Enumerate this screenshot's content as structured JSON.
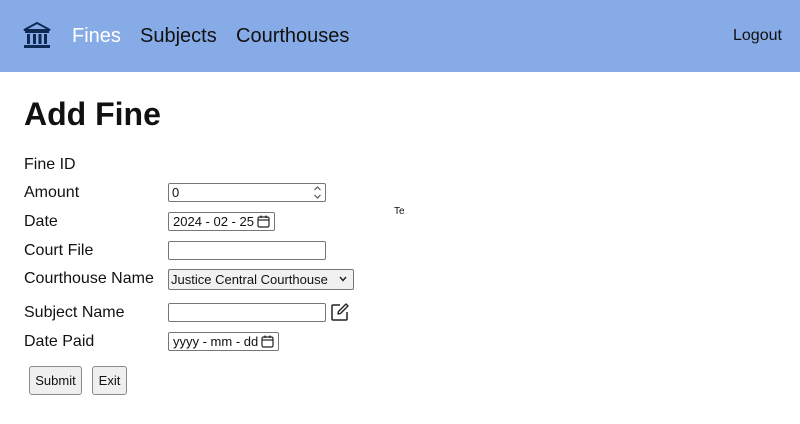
{
  "nav": {
    "logo": "bank-icon",
    "links": [
      "Fines",
      "Subjects",
      "Courthouses"
    ],
    "active": "Fines",
    "logout": "Logout"
  },
  "page": {
    "title": "Add Fine"
  },
  "form": {
    "labels": {
      "fine_id": "Fine ID",
      "amount": "Amount",
      "date": "Date",
      "court_file": "Court File",
      "courthouse": "Courthouse Name",
      "subject": "Subject Name",
      "date_paid": "Date Paid"
    },
    "values": {
      "amount": "0",
      "date": "2024 - 02 - 25",
      "court_file": "",
      "courthouse": "Justice Central Courthouse",
      "subject": "",
      "date_paid": "yyyy - mm - dd"
    },
    "stray_text": "Te",
    "buttons": {
      "submit": "Submit",
      "exit": "Exit"
    }
  },
  "colors": {
    "navbar": "#86abe6",
    "active_link": "#ffffff"
  }
}
